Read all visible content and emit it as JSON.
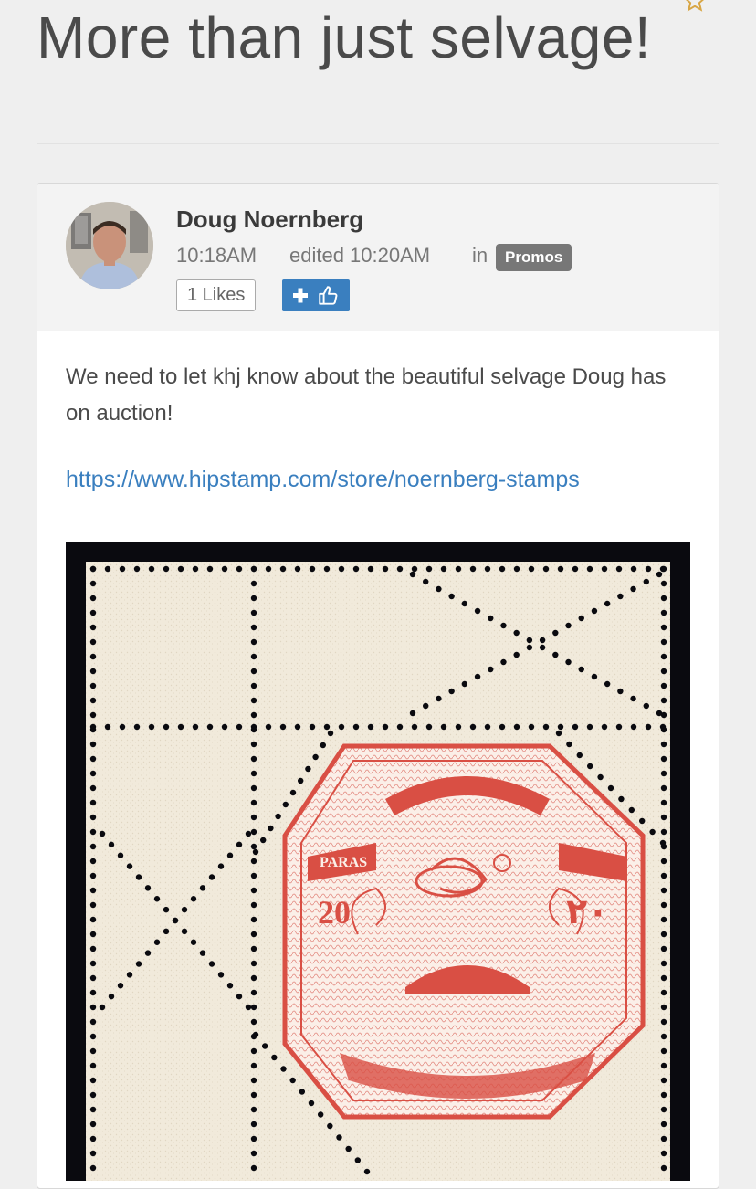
{
  "page": {
    "title": "More than just selvage!"
  },
  "post": {
    "author": "Doug Noernberg",
    "time": "10:18AM",
    "edited": "edited 10:20AM",
    "in_label": "in",
    "category": "Promos",
    "likes_label": "1 Likes",
    "body": "We need to let khj know about the beautiful selvage Doug has on auction!",
    "link": "https://www.hipstamp.com/store/noernberg-stamps"
  },
  "stamp": {
    "value_left": "20",
    "value_right": "٢٠",
    "denomination": "PARAS"
  },
  "colors": {
    "accent": "#3a7fbf",
    "badge": "#777777",
    "stamp_red": "#d94f44",
    "paper": "#f1eadb"
  },
  "icons": [
    "star-icon",
    "plus-icon",
    "thumbs-up-icon"
  ]
}
